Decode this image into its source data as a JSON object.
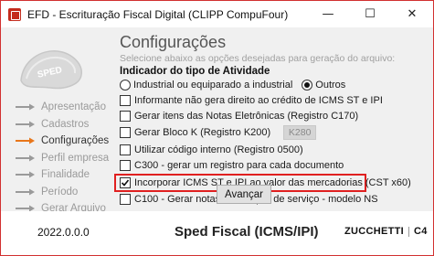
{
  "window": {
    "title": "EFD - Escrituração Fiscal Digital (CLIPP CompuFour)",
    "accent_color": "#d23030"
  },
  "controls": {
    "minimize": "—",
    "maximize": "☐",
    "close": "✕"
  },
  "logo": {
    "text": "SPED"
  },
  "nav": {
    "items": [
      {
        "label": "Apresentação",
        "state": "done"
      },
      {
        "label": "Cadastros",
        "state": "done"
      },
      {
        "label": "Configurações",
        "state": "active"
      },
      {
        "label": "Perfil empresa",
        "state": "pending"
      },
      {
        "label": "Finalidade",
        "state": "pending"
      },
      {
        "label": "Período",
        "state": "pending"
      },
      {
        "label": "Gerar Arquivo",
        "state": "pending"
      }
    ],
    "active_arrow_color": "#e8761a",
    "arrow_color": "#9a9a9a"
  },
  "main": {
    "heading": "Configurações",
    "subtitle": "Selecione abaixo as opções desejadas para geração do arquivo:",
    "activity_label": "Indicador do tipo de Atividade",
    "radios": [
      {
        "label": "Industrial ou equiparado a industrial",
        "checked": false
      },
      {
        "label": "Outros",
        "checked": true
      }
    ],
    "options": [
      {
        "label": "Informante não gera direito ao crédito de ICMS ST e IPI",
        "checked": false
      },
      {
        "label": "Gerar itens das Notas Eletrônicas (Registro C170)",
        "checked": false
      },
      {
        "label": "Gerar Bloco K (Registro K200)",
        "checked": false
      },
      {
        "label": "Utilizar código interno (Registro 0500)",
        "checked": false
      },
      {
        "label": "C300 - gerar um registro para cada documento",
        "checked": false
      },
      {
        "label": "Incorporar ICMS ST e IPI ao valor das mercadorias (CST x60)",
        "checked": true
      },
      {
        "label": "C100 - Gerar notas de compra de serviço - modelo NS",
        "checked": false
      }
    ],
    "k280_button": "K280",
    "advance_button": "Avançar"
  },
  "footer": {
    "version": "2022.0.0.0",
    "product": "Sped Fiscal (ICMS/IPI)",
    "brand": "ZUCCHETTI",
    "brand_mark": "C4"
  }
}
